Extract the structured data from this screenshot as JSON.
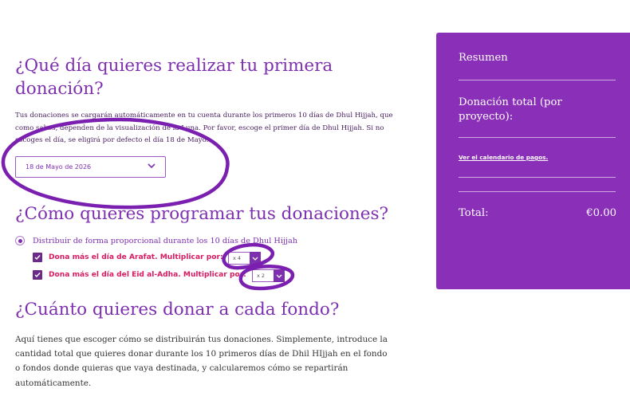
{
  "sections": {
    "first_day": {
      "title": "¿Qué día quieres realizar tu primera donación?",
      "description": "Tus donaciones se cargarán automáticamente en tu cuenta durante los primeros 10 días de Dhul Hijjah, que como sabes, dependen de la visualización de la Luna. Por favor, escoge el primer día de Dhul Hijjah. Si no escoges el día, se eligirá por defecto el día 18 de Mayo.",
      "date_value": "18 de Mayo de 2026"
    },
    "schedule": {
      "title": "¿Cómo quieres programar tus donaciones?",
      "radio_label": "Distribuir de forma proporcional durante los 10 días de Dhul Hijjah",
      "arafat_label": "Dona más el día de Arafat. Multiplicar por:",
      "arafat_value": "x 4",
      "eid_label": "Dona más el día del Eid al-Adha. Multiplicar por:",
      "eid_value": "x 2"
    },
    "amount": {
      "title": "¿Cuánto quieres donar a cada fondo?",
      "description": "Aquí tienes que escoger cómo se distribuirán tus donaciones. Simplemente, introduce la cantidad total que quieres donar durante los 10 primeros días de Dhil HIjjah en el fondo o fondos donde quieras que vaya destinada, y calcularemos cómo se repartirán automáticamente."
    }
  },
  "summary": {
    "title": "Resumen",
    "total_per_project": "Donación total (por proyecto):",
    "calendar_link": "Ver el calendario de pagos.",
    "total_label": "Total:",
    "total_amount": "€0.00"
  },
  "colors": {
    "accent": "#7d2fb0",
    "sidebar_bg": "#8a2fb8",
    "highlight_text": "#d81b60",
    "annotation": "#7a1fb0"
  },
  "icons": {
    "date_chevron": "chevron-down-icon",
    "mult_chevron": "chevron-down-icon",
    "checkbox_mark": "check-icon"
  }
}
